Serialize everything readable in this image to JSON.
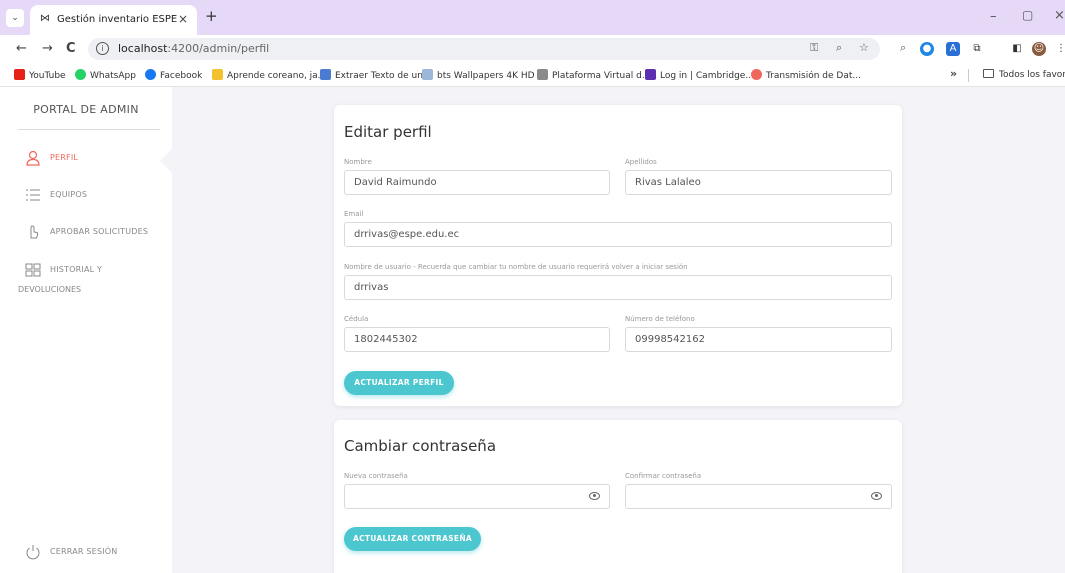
{
  "browser": {
    "tab_title": "Gestión inventario ESPE",
    "tab_list_glyph": "⌄",
    "tab_favicon_glyph": "⋈",
    "tab_close_glyph": "×",
    "new_tab_glyph": "+",
    "url_host": "localhost",
    "url_path": ":4200/admin/perfil",
    "back_glyph": "←",
    "forward_glyph": "→",
    "reload_glyph": "C",
    "window_min": "–",
    "window_max": "▢",
    "window_close": "×",
    "more_bookmarks": "»",
    "bookmarks": [
      {
        "label": "YouTube",
        "color": "#e62117"
      },
      {
        "label": "WhatsApp",
        "color": "#25d366"
      },
      {
        "label": "Facebook",
        "color": "#1877f2"
      },
      {
        "label": "Aprende coreano, ja...",
        "color": "#f2c12e"
      },
      {
        "label": "Extraer Texto de un...",
        "color": "#4a7bd0"
      },
      {
        "label": "bts Wallpapers 4K HD",
        "color": "#9bb7d9"
      },
      {
        "label": "Plataforma Virtual d...",
        "color": "#8a8a8a"
      },
      {
        "label": "Log in | Cambridge...",
        "color": "#5b2fb0"
      },
      {
        "label": "Transmisión de Dat...",
        "color": "#f0675c"
      }
    ],
    "bookmarks_folder": "Todos los favoritos"
  },
  "sidebar": {
    "brand": "PORTAL DE ADMIN",
    "items": [
      {
        "label": "PERFIL",
        "icon": "user-icon",
        "active": true
      },
      {
        "label": "EQUIPOS",
        "icon": "list-icon"
      },
      {
        "label": "APROBAR SOLICITUDES",
        "icon": "hand-icon"
      },
      {
        "label": "HISTORIAL Y",
        "label2": "DEVOLUCIONES",
        "icon": "history-icon"
      }
    ],
    "logout": "CERRAR SESIÓN"
  },
  "profile": {
    "title": "Editar perfil",
    "nombre_label": "Nombre",
    "nombre_value": "David Raimundo",
    "apellidos_label": "Apellidos",
    "apellidos_value": "Rivas Lalaleo",
    "email_label": "Email",
    "email_value": "drrivas@espe.edu.ec",
    "username_label": "Nombre de usuario - Recuerda que cambiar tu nombre de usuario requerirá volver a iniciar sesión",
    "username_value": "drrivas",
    "cedula_label": "Cédula",
    "cedula_value": "1802445302",
    "telefono_label": "Número de teléfono",
    "telefono_value": "09998542162",
    "submit_label": "ACTUALIZAR PERFIL"
  },
  "password": {
    "title": "Cambiar contraseña",
    "new_label": "Nueva contraseña",
    "confirm_label": "Confirmar contraseña",
    "submit_label": "ACTUALIZAR CONTRASEÑA"
  },
  "colors": {
    "accent": "#4cc6cf",
    "active": "#f0675c",
    "tabbar": "#e6d9f7"
  }
}
